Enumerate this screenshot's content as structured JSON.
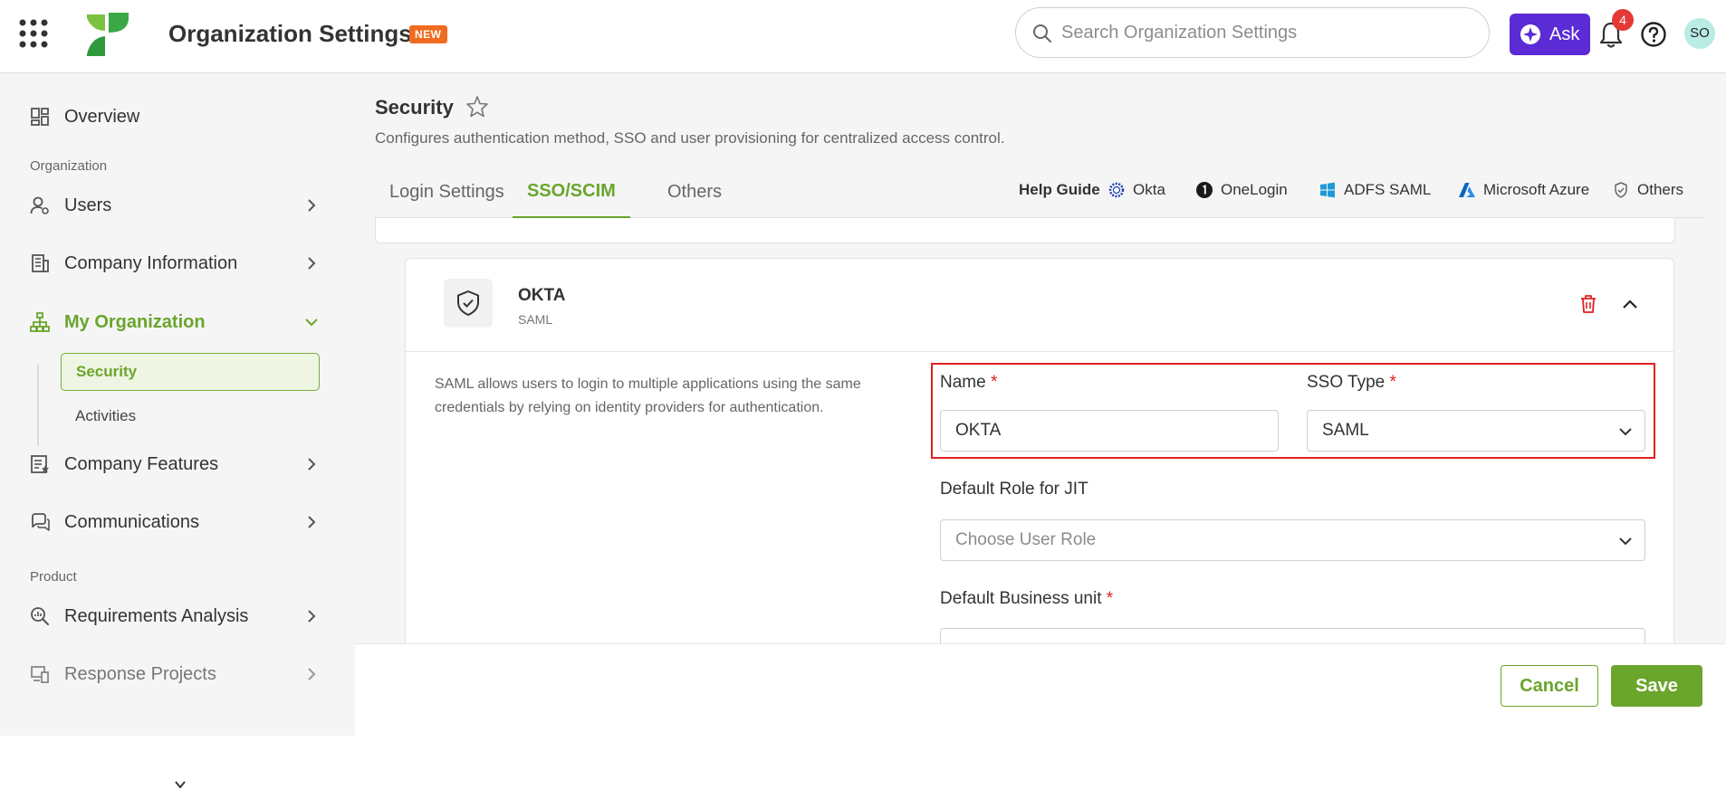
{
  "header": {
    "title": "Organization Settings",
    "new_badge": "NEW",
    "search_placeholder": "Search Organization Settings",
    "ask_label": "Ask",
    "notification_count": "4",
    "avatar_initials": "SO"
  },
  "sidebar": {
    "overview": "Overview",
    "section_organization": "Organization",
    "users": "Users",
    "company_information": "Company Information",
    "my_organization": "My Organization",
    "sub_security": "Security",
    "sub_activities": "Activities",
    "company_features": "Company Features",
    "communications": "Communications",
    "section_product": "Product",
    "requirements_analysis": "Requirements Analysis",
    "response_projects": "Response Projects"
  },
  "page": {
    "title": "Security",
    "description": "Configures authentication method, SSO and user provisioning for centralized access control.",
    "tabs": [
      "Login Settings",
      "SSO/SCIM",
      "Others"
    ],
    "active_tab": "SSO/SCIM",
    "help_guide": {
      "label": "Help Guide",
      "links": [
        "Okta",
        "OneLogin",
        "ADFS SAML",
        "Microsoft Azure",
        "Others"
      ]
    }
  },
  "provider_card": {
    "name": "OKTA",
    "type": "SAML",
    "description": "SAML allows users to login to multiple applications using the same credentials by relying on identity providers for authentication.",
    "fields": {
      "name_label": "Name",
      "name_value": "OKTA",
      "sso_type_label": "SSO Type",
      "sso_type_value": "SAML",
      "default_role_label": "Default Role for JIT",
      "default_role_placeholder": "Choose User Role",
      "default_bu_label": "Default Business unit",
      "required_mark": "*"
    }
  },
  "footer": {
    "cancel_label": "Cancel",
    "save_label": "Save"
  },
  "colors": {
    "brand_green": "#6aa52c",
    "ask_purple": "#5b2bd6",
    "alert_red": "#e02020",
    "new_orange": "#f06b1f"
  }
}
